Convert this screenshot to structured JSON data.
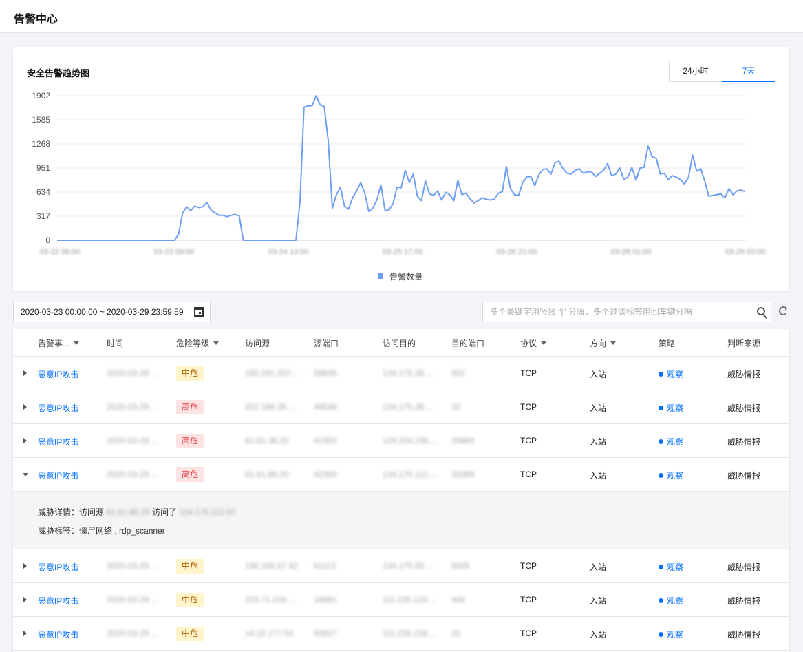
{
  "page": {
    "title": "告警中心"
  },
  "chart_card": {
    "title": "安全告警趋势图",
    "range_options": [
      "24小时",
      "7天"
    ],
    "active_range": "7天"
  },
  "chart_data": {
    "type": "line",
    "title": "安全告警趋势图",
    "legend": [
      "告警数量"
    ],
    "legend_position": "bottom",
    "series_color": "#6f9ef5",
    "grid": true,
    "yticks": [
      "1902",
      "1585",
      "1268",
      "951",
      "634",
      "317",
      "0"
    ],
    "ylim": [
      0,
      1902
    ],
    "xtick_labels": [
      "03-22 06:00",
      "03-23 09:00",
      "03-24 13:00",
      "03-25 17:00",
      "03-26 21:00",
      "03-28 01:00",
      "03-29 03:00"
    ],
    "series": [
      {
        "name": "告警数量",
        "values": [
          0,
          0,
          0,
          0,
          0,
          0,
          0,
          0,
          0,
          0,
          0,
          0,
          0,
          0,
          0,
          0,
          0,
          0,
          0,
          0,
          0,
          0,
          0,
          0,
          0,
          0,
          0,
          0,
          0,
          0,
          80,
          360,
          440,
          390,
          450,
          430,
          440,
          500,
          400,
          360,
          330,
          330,
          310,
          330,
          340,
          320,
          0,
          0,
          0,
          0,
          0,
          0,
          0,
          0,
          0,
          0,
          0,
          0,
          0,
          0,
          500,
          1750,
          1770,
          1770,
          1900,
          1780,
          1760,
          1300,
          420,
          600,
          700,
          450,
          410,
          560,
          650,
          760,
          620,
          380,
          420,
          530,
          730,
          390,
          400,
          480,
          700,
          690,
          920,
          760,
          870,
          580,
          520,
          780,
          610,
          590,
          650,
          530,
          630,
          600,
          520,
          790,
          600,
          620,
          550,
          490,
          520,
          560,
          540,
          530,
          540,
          620,
          640,
          970,
          680,
          600,
          590,
          760,
          830,
          840,
          720,
          860,
          930,
          940,
          870,
          1020,
          1040,
          940,
          880,
          870,
          920,
          940,
          880,
          900,
          900,
          840,
          880,
          920,
          1010,
          850,
          870,
          950,
          800,
          830,
          960,
          790,
          950,
          960,
          1240,
          1100,
          1080,
          870,
          880,
          800,
          850,
          830,
          800,
          740,
          830,
          1120,
          910,
          940,
          780,
          580,
          590,
          600,
          610,
          560,
          680,
          600,
          650,
          660,
          640
        ]
      }
    ]
  },
  "filters": {
    "date_range": "2020-03-23 00:00:00 ~ 2020-03-29 23:59:59",
    "search_placeholder": "多个关键字用竖线 “|” 分隔，多个过滤标签用回车键分隔"
  },
  "table": {
    "headers": [
      "告警事...",
      "时间",
      "危险等级",
      "访问源",
      "源端口",
      "访问目的",
      "目的端口",
      "协议",
      "方向",
      "策略",
      "判断来源"
    ],
    "rows": [
      {
        "event": "恶意IP攻击",
        "time": "2020-03-29 ...",
        "level": "中危",
        "level_type": "mid",
        "src": "192.241.207...",
        "sport": "59636",
        "dst": "134.175.28....",
        "dport": "502",
        "proto": "TCP",
        "dir": "入站",
        "policy": "观察",
        "source": "威胁情报",
        "expanded": false
      },
      {
        "event": "恶意IP攻击",
        "time": "2020-03-29 ...",
        "level": "高危",
        "level_type": "high",
        "src": "202.186.35....",
        "sport": "49549",
        "dst": "134.175.28....",
        "dport": "22",
        "proto": "TCP",
        "dir": "入站",
        "policy": "观察",
        "source": "威胁情报",
        "expanded": false
      },
      {
        "event": "恶意IP攻击",
        "time": "2020-03-29 ...",
        "level": "高危",
        "level_type": "high",
        "src": "61.61.38.20",
        "sport": "42350",
        "dst": "129.204.236....",
        "dport": "33893",
        "proto": "TCP",
        "dir": "入站",
        "policy": "观察",
        "source": "威胁情报",
        "expanded": false
      },
      {
        "event": "恶意IP攻击",
        "time": "2020-03-29 ...",
        "level": "高危",
        "level_type": "high",
        "src": "61.61.88.20",
        "sport": "42350",
        "dst": "134.175.112....",
        "dport": "33389",
        "proto": "TCP",
        "dir": "入站",
        "policy": "观察",
        "source": "威胁情报",
        "expanded": true
      }
    ],
    "expanded_detail": {
      "line1_prefix": "威胁详情：访问源",
      "line1_src": "61.61.88.20",
      "line1_mid": "访问了",
      "line1_dst": "134.175.112.97",
      "line2": "威胁标签：僵尸网络 , rdp_scanner"
    },
    "rows_after": [
      {
        "event": "恶意IP攻击",
        "time": "2020-03-29 ...",
        "level": "中危",
        "level_type": "mid",
        "src": "196.106.67.42",
        "sport": "61113",
        "dst": "134.175.00....",
        "dport": "5005",
        "proto": "TCP",
        "dir": "入站",
        "policy": "观察",
        "source": "威胁情报"
      },
      {
        "event": "恶意IP攻击",
        "time": "2020-03-29 ...",
        "level": "中危",
        "level_type": "mid",
        "src": "223.71.224....",
        "sport": "18881",
        "dst": "111.230.133....",
        "dport": "445",
        "proto": "TCP",
        "dir": "入站",
        "policy": "观察",
        "source": "威胁情报"
      },
      {
        "event": "恶意IP攻击",
        "time": "2020-03-29 ...",
        "level": "中危",
        "level_type": "mid",
        "src": "14.22.177.53",
        "sport": "50827",
        "dst": "111.230.159....",
        "dport": "22",
        "proto": "TCP",
        "dir": "入站",
        "policy": "观察",
        "source": "威胁情报"
      }
    ]
  }
}
